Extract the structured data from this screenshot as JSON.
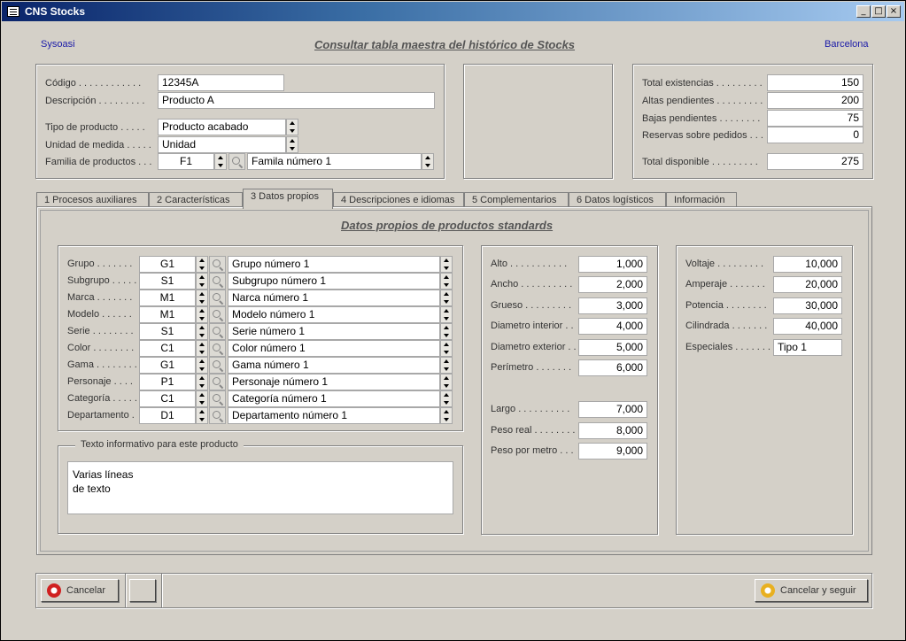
{
  "window": {
    "title": "CNS Stocks",
    "min_label": "_",
    "max_label": "□",
    "close_label": "×"
  },
  "header": {
    "company": "Sysoasi",
    "title": "Consultar tabla maestra del histórico de Stocks",
    "location": "Barcelona"
  },
  "product": {
    "codigo": {
      "label": "Código . . . . . . . . . . . .",
      "value": "12345A"
    },
    "descripcion": {
      "label": "Descripción . . . . . . . . .",
      "value": "Producto A"
    },
    "tipo": {
      "label": "Tipo de producto . . . . .",
      "value": "Producto acabado"
    },
    "unidad": {
      "label": "Unidad de medida . . . . .",
      "value": "Unidad"
    },
    "familia": {
      "label": "Familia de productos . . .",
      "code": "F1",
      "value": "Famila número 1"
    }
  },
  "totals": {
    "existencias": {
      "label": "Total existencias . . . . . . . . .",
      "value": "150"
    },
    "altas": {
      "label": "Altas pendientes . . . . . . . . .",
      "value": "200"
    },
    "bajas": {
      "label": "Bajas pendientes . . . . . . . .",
      "value": "75"
    },
    "reservas": {
      "label": "Reservas sobre pedidos . . .",
      "value": "0"
    },
    "disponible": {
      "label": "Total disponible . . . . . . . . .",
      "value": "275"
    }
  },
  "tabs": [
    {
      "label": "1  Procesos auxiliares"
    },
    {
      "label": "2  Características"
    },
    {
      "label": "3  Datos propios"
    },
    {
      "label": "4  Descripciones e idiomas"
    },
    {
      "label": "5  Complementarios"
    },
    {
      "label": "6  Datos logísticos"
    },
    {
      "label": "Información"
    }
  ],
  "panel": {
    "title": "Datos propios de productos standards",
    "rows": [
      {
        "label": "Grupo . . . . . . .",
        "code": "G1",
        "value": "Grupo número 1"
      },
      {
        "label": "Subgrupo . . . . .",
        "code": "S1",
        "value": "Subgrupo número 1"
      },
      {
        "label": "Marca . . . . . . .",
        "code": "M1",
        "value": "Narca número 1"
      },
      {
        "label": "Modelo . . . . . .",
        "code": "M1",
        "value": "Modelo número 1"
      },
      {
        "label": "Serie . . . . . . . .",
        "code": "S1",
        "value": "Serie número 1"
      },
      {
        "label": "Color . . . . . . . .",
        "code": "C1",
        "value": "Color número 1"
      },
      {
        "label": "Gama . . . . . . . .",
        "code": "G1",
        "value": "Gama número 1"
      },
      {
        "label": "Personaje . . . .",
        "code": "P1",
        "value": "Personaje número 1"
      },
      {
        "label": "Categoría . . . . .",
        "code": "C1",
        "value": "Categoría número 1"
      },
      {
        "label": "Departamento .",
        "code": "D1",
        "value": "Departamento número 1"
      }
    ],
    "info_legend": "Texto informativo para este producto",
    "info_line1": "Varias líneas",
    "info_line2": "de texto",
    "dims": [
      {
        "label": "Alto . . . . . . . . . . .",
        "value": "1,000"
      },
      {
        "label": "Ancho . . . . . . . . . .",
        "value": "2,000"
      },
      {
        "label": "Grueso . . . . . . . . .",
        "value": "3,000"
      },
      {
        "label": "Diametro interior . .",
        "value": "4,000"
      },
      {
        "label": "Diametro exterior . .",
        "value": "5,000"
      },
      {
        "label": "Perímetro . . . . . . .",
        "value": "6,000"
      },
      {
        "label": "Largo . . . . . . . . . .",
        "value": "7,000"
      },
      {
        "label": "Peso real . . . . . . . .",
        "value": "8,000"
      },
      {
        "label": "Peso por metro . . .",
        "value": "9,000"
      }
    ],
    "elec": [
      {
        "label": "Voltaje . . . . . . . . .",
        "value": "10,000"
      },
      {
        "label": "Amperaje . . . . . . .",
        "value": "20,000"
      },
      {
        "label": "Potencia . . . . . . . .",
        "value": "30,000"
      },
      {
        "label": "Cilindrada . . . . . . .",
        "value": "40,000"
      },
      {
        "label": "Especiales . . . . . . .",
        "value": "Tipo 1"
      }
    ]
  },
  "footer": {
    "cancel_label": "Cancelar",
    "cancel_continue_label": "Cancelar y seguir"
  }
}
